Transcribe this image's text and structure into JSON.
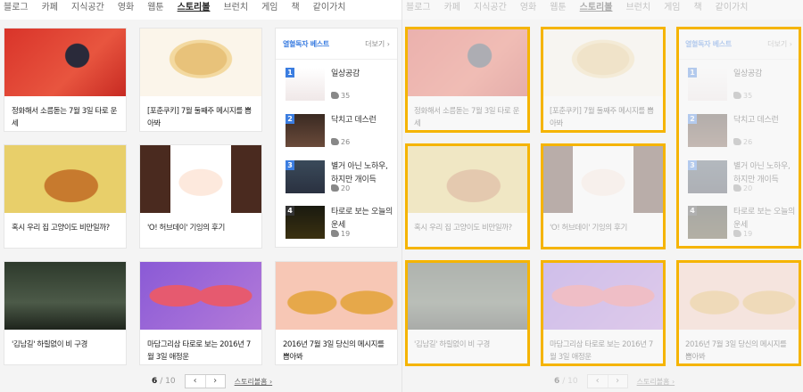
{
  "nav": {
    "items": [
      "블로그",
      "카페",
      "지식공간",
      "영화",
      "웹툰",
      "스토리볼",
      "브런치",
      "게임",
      "책",
      "같이가치"
    ],
    "active_index": 5
  },
  "cards": [
    {
      "title": "정화해서 소름돋는 7월 3일 타로 운세",
      "image": "tarot-woman-red"
    },
    {
      "title": "[포춘쿠키] 7월 둘째주 메시지를 뽑아봐",
      "image": "fortune-cookie"
    },
    {
      "title": "혹시 우리 집 고양이도 비만일까?",
      "image": "cat-question"
    },
    {
      "title": "'O! 허브데이' 기잉의 후기",
      "image": "anime-girl"
    },
    {
      "title": "'김남길' 하릴없이 비 구경",
      "image": "rain-scene"
    },
    {
      "title": "마담그리삼 타로로 보는 2016년 7월 3일 애정운",
      "image": "cards-7-3"
    },
    {
      "title": "2016년 7월 3일 당신의 메시지를 뽑아봐",
      "image": "fortune-cookies-7-3"
    }
  ],
  "widget": {
    "title": "열혈독자 베스트",
    "more": "더보기 ›",
    "items": [
      {
        "rank": "1",
        "name": "일상공감",
        "count": "35"
      },
      {
        "rank": "2",
        "name": "닥치고 데스런",
        "count": "26"
      },
      {
        "rank": "3",
        "name": "별거 아닌 노하우, 하지만 개이득",
        "count": "20"
      },
      {
        "rank": "4",
        "name": "타로로 보는 오늘의 운세",
        "count": "19"
      }
    ]
  },
  "pager": {
    "current": "6",
    "total": "/ 10",
    "prev": "‹",
    "next": "›",
    "home": "스토리볼홈 ›"
  },
  "colors": {
    "highlight": "#f5b400",
    "accent": "#3b7de0"
  }
}
